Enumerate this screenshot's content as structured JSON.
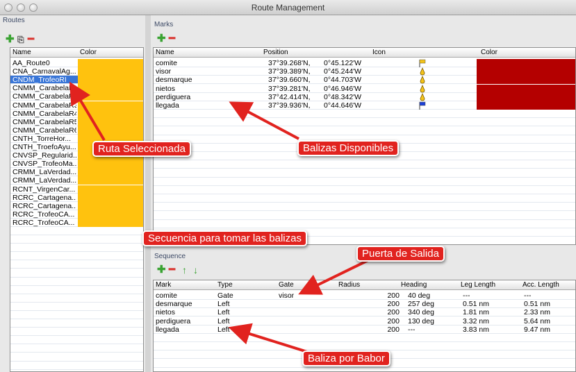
{
  "window": {
    "title": "Route Management"
  },
  "routes_panel": {
    "label": "Routes",
    "columns": [
      "Name",
      "Color"
    ],
    "rows": [
      {
        "name": "AA_Route0",
        "selected": false
      },
      {
        "name": "CNA_CarnavalAg...",
        "selected": false
      },
      {
        "name": "CNDM_TrofeoRI",
        "selected": true
      },
      {
        "name": "CNMM_CarabelaR",
        "selected": false
      },
      {
        "name": "CNMM_CarabelaR2",
        "selected": false
      },
      {
        "name": "CNMM_CarabelaR3",
        "selected": false
      },
      {
        "name": "CNMM_CarabelaR4",
        "selected": false
      },
      {
        "name": "CNMM_CarabelaR5",
        "selected": false
      },
      {
        "name": "CNMM_CarabelaR6",
        "selected": false
      },
      {
        "name": "CNTH_TorreHor...",
        "selected": false
      },
      {
        "name": "CNTH_TroefoAyu...",
        "selected": false
      },
      {
        "name": "CNVSP_Regularid...",
        "selected": false
      },
      {
        "name": "CNVSP_TrofeoMa...",
        "selected": false
      },
      {
        "name": "CRMM_LaVerdad...",
        "selected": false
      },
      {
        "name": "CRMM_LaVerdad...",
        "selected": false
      },
      {
        "name": "RCNT_VirgenCar...",
        "selected": false
      },
      {
        "name": "RCRC_Cartagena...",
        "selected": false
      },
      {
        "name": "RCRC_Cartagena...",
        "selected": false
      },
      {
        "name": "RCRC_TrofeoCA...",
        "selected": false
      },
      {
        "name": "RCRC_TrofeoCA...",
        "selected": false
      }
    ]
  },
  "marks_panel": {
    "label": "Marks",
    "columns": [
      "Name",
      "Position",
      "Icon",
      "Color"
    ],
    "rows": [
      {
        "name": "comite",
        "lat": "37°39.268'N,",
        "lon": "0°45.122'W",
        "icon": "yellow-flag-icon"
      },
      {
        "name": "visor",
        "lat": "37°39.389'N,",
        "lon": "0°45.244'W",
        "icon": "yellow-buoy-icon"
      },
      {
        "name": "desmarque",
        "lat": "37°39.660'N,",
        "lon": "0°44.703'W",
        "icon": "yellow-buoy-icon"
      },
      {
        "name": "nietos",
        "lat": "37°39.281'N,",
        "lon": "0°46.946'W",
        "icon": "yellow-buoy-icon"
      },
      {
        "name": "perdiguera",
        "lat": "37°42.414'N,",
        "lon": "0°48.342'W",
        "icon": "yellow-buoy-icon"
      },
      {
        "name": "llegada",
        "lat": "37°39.936'N,",
        "lon": "0°44.646'W",
        "icon": "blue-flag-icon"
      }
    ]
  },
  "sequence_panel": {
    "label": "Sequence",
    "columns": [
      "Mark",
      "Type",
      "Gate",
      "Radius",
      "Heading",
      "Leg Length",
      "Acc. Length"
    ],
    "rows": [
      {
        "mark": "comite",
        "type": "Gate",
        "gate": "visor",
        "radius": "200",
        "heading": "40 deg",
        "leg": "---",
        "acc": "---"
      },
      {
        "mark": "desmarque",
        "type": "Left",
        "gate": "",
        "radius": "200",
        "heading": "257 deg",
        "leg": "0.51 nm",
        "acc": "0.51 nm"
      },
      {
        "mark": "nietos",
        "type": "Left",
        "gate": "",
        "radius": "200",
        "heading": "340 deg",
        "leg": "1.81 nm",
        "acc": "2.33 nm"
      },
      {
        "mark": "perdiguera",
        "type": "Left",
        "gate": "",
        "radius": "200",
        "heading": "130 deg",
        "leg": "3.32 nm",
        "acc": "5.64 nm"
      },
      {
        "mark": "llegada",
        "type": "Left",
        "gate": "",
        "radius": "200",
        "heading": "---",
        "leg": "3.83 nm",
        "acc": "9.47 nm"
      }
    ]
  },
  "annotations": {
    "ruta": "Ruta Seleccionada",
    "balizas": "Balizas Disponibles",
    "secuencia": "Secuencia para tomar las balizas",
    "puerta": "Puerta de Salida",
    "babor": "Baliza por Babor"
  },
  "colors": {
    "route_color": "#ffc20e",
    "mark_color": "#b40000",
    "selection": "#3875d7",
    "callout": "#e1231f"
  }
}
